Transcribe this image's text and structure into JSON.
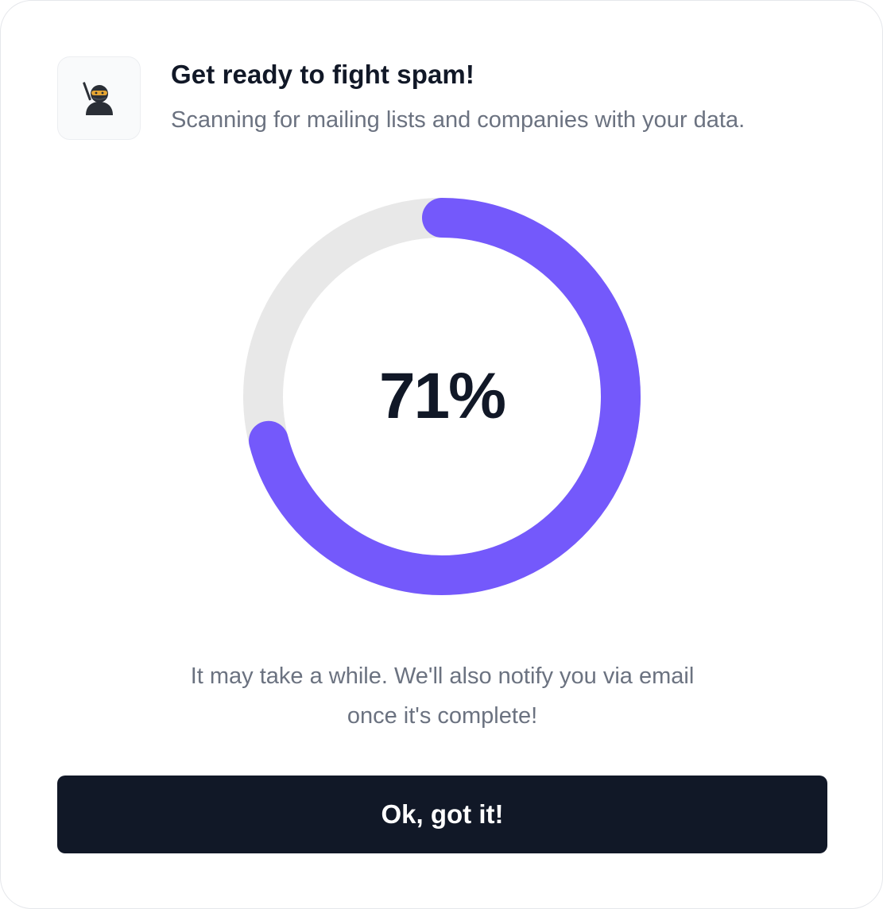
{
  "header": {
    "icon": "ninja-icon",
    "title": "Get ready to fight spam!",
    "subtitle": "Scanning for mailing lists and companies with your data."
  },
  "progress": {
    "percent": 71,
    "label": "71%",
    "track_color": "#e8e8e8",
    "fill_color": "#7459fb"
  },
  "note": {
    "line1": "It may take a while. We'll also notify you via email",
    "line2": "once it's complete!"
  },
  "action": {
    "label": "Ok, got it!",
    "color": "#111827"
  }
}
